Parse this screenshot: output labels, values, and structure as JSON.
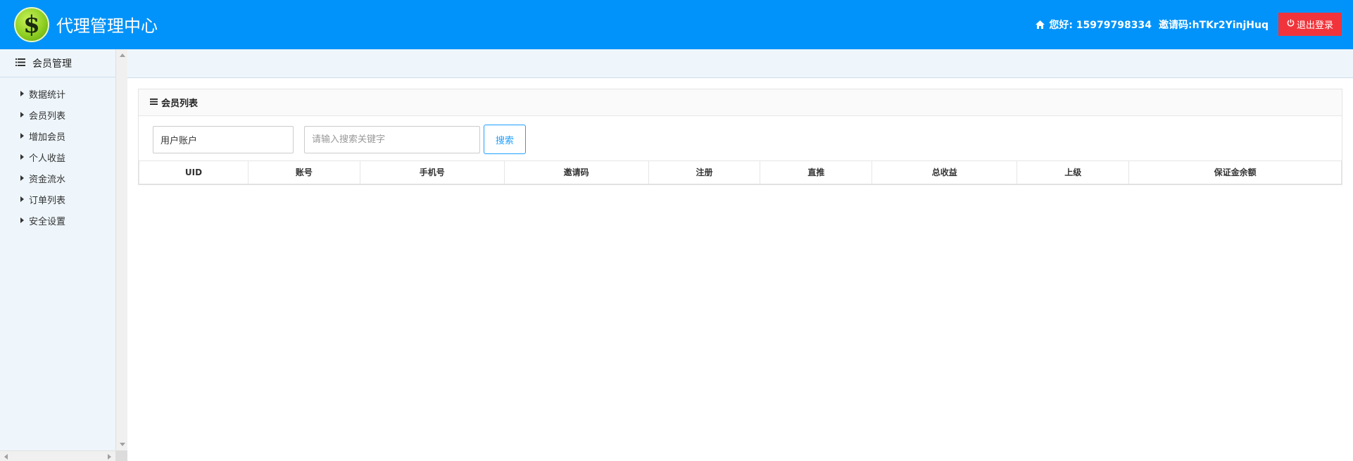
{
  "header": {
    "app_title": "代理管理中心",
    "logo_symbol": "$",
    "greeting": "您好: 15979798334",
    "invite": "邀请码:hTKr2YinjHuq",
    "logout_label": "退出登录",
    "colors": {
      "header_bg": "#0193f9",
      "logout_bg": "#f1343b"
    }
  },
  "sidebar": {
    "title": "会员管理",
    "items": [
      {
        "label": "数据统计"
      },
      {
        "label": "会员列表"
      },
      {
        "label": "增加会员"
      },
      {
        "label": "个人收益"
      },
      {
        "label": "资金流水"
      },
      {
        "label": "订单列表"
      },
      {
        "label": "安全设置"
      }
    ]
  },
  "panel": {
    "title": "会员列表",
    "search": {
      "field_select": "用户账户",
      "placeholder": "请输入搜索关键字",
      "value": "",
      "button_label": "搜索"
    },
    "table": {
      "columns": [
        "UID",
        "账号",
        "手机号",
        "邀请码",
        "注册",
        "直推",
        "总收益",
        "上级",
        "保证金余额"
      ]
    }
  }
}
